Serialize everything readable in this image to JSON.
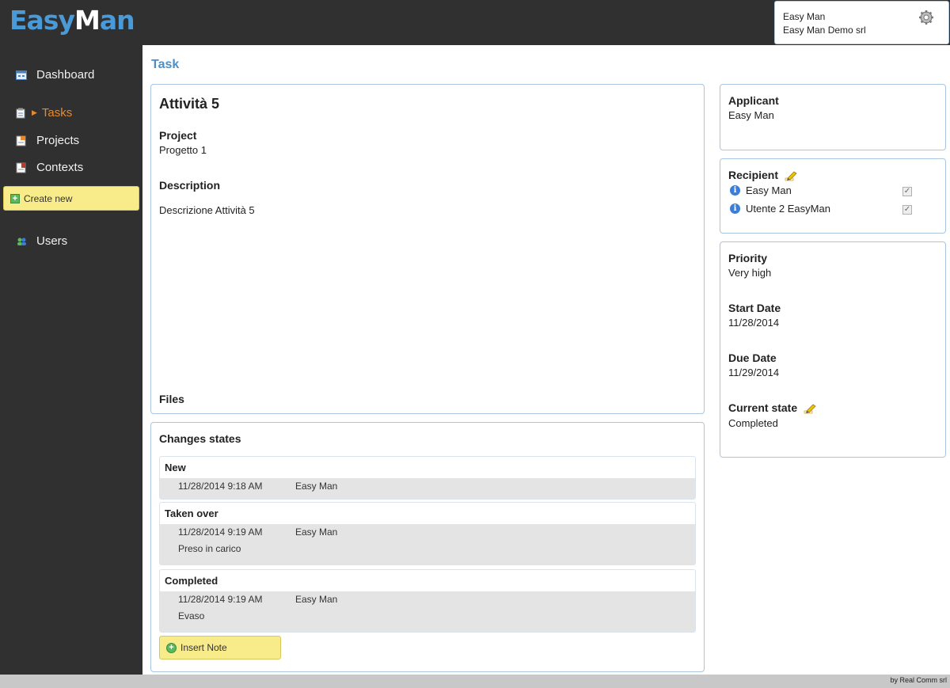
{
  "logo": {
    "part1": "Easy",
    "part2": "M",
    "part3": "an"
  },
  "user": {
    "name": "Easy Man",
    "company": "Easy Man Demo srl"
  },
  "sidebar": {
    "items": [
      {
        "label": "Dashboard"
      },
      {
        "label": "Tasks"
      },
      {
        "label": "Projects"
      },
      {
        "label": "Contexts"
      },
      {
        "label": "Users"
      }
    ],
    "create_label": "Create new"
  },
  "page": {
    "title": "Task"
  },
  "task": {
    "title": "Attività 5",
    "project_label": "Project",
    "project_value": "Progetto 1",
    "description_label": "Description",
    "description_value": "Descrizione Attività 5",
    "files_label": "Files"
  },
  "changes": {
    "title": "Changes states",
    "states": [
      {
        "name": "New",
        "date": "11/28/2014 9:18 AM",
        "user": "Easy Man",
        "note": ""
      },
      {
        "name": "Taken over",
        "date": "11/28/2014 9:19 AM",
        "user": "Easy Man",
        "note": "Preso in carico"
      },
      {
        "name": "Completed",
        "date": "11/28/2014 9:19 AM",
        "user": "Easy Man",
        "note": "Evaso"
      }
    ],
    "insert_note_label": "Insert Note"
  },
  "applicant": {
    "label": "Applicant",
    "value": "Easy Man"
  },
  "recipient": {
    "label": "Recipient",
    "items": [
      {
        "name": "Easy Man"
      },
      {
        "name": "Utente 2 EasyMan"
      }
    ]
  },
  "details": {
    "priority_label": "Priority",
    "priority_value": "Very high",
    "start_label": "Start Date",
    "start_value": "11/28/2014",
    "due_label": "Due Date",
    "due_value": "11/29/2014",
    "state_label": "Current state",
    "state_value": "Completed"
  },
  "footer": {
    "text": "by Real Comm srl"
  },
  "colors": {
    "accent": "#4a8fc9",
    "active_nav": "#e8892d",
    "button_yellow": "#f8ec8a"
  }
}
